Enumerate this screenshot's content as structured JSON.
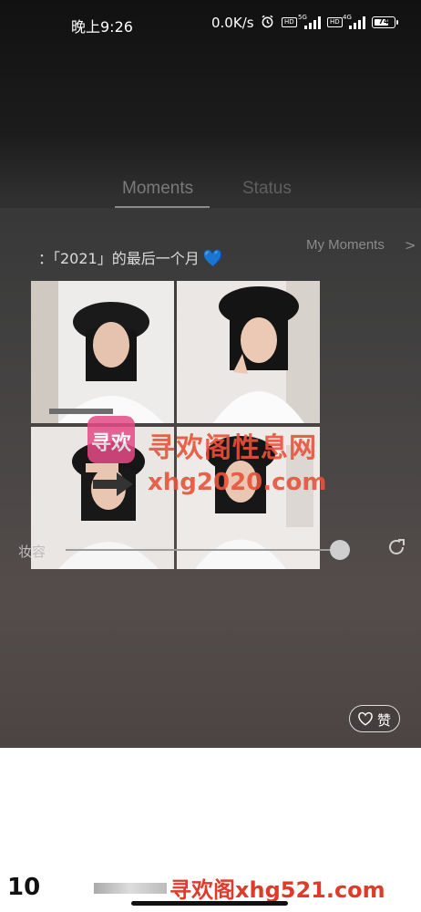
{
  "status_bar": {
    "time": "晚上9:26",
    "net_speed": "0.0K/s",
    "sim1_tag": "5G",
    "sim2_tag": "4G",
    "hd_label": "HD",
    "battery": "74",
    "battery_level": 0.74,
    "icons": [
      "alarm-icon",
      "signal-icon",
      "battery-icon"
    ]
  },
  "tabs": [
    {
      "label": "Moments",
      "active": true
    },
    {
      "label": "Status",
      "active": false
    }
  ],
  "my_moments_link": "My Moments",
  "post": {
    "text": "：「2021」的最后一个月",
    "emoji": "💙",
    "photos": [
      "photo-1",
      "photo-2",
      "photo-3",
      "photo-4"
    ]
  },
  "watermark": {
    "logo_text": "寻欢",
    "title": "寻欢阁性息网",
    "url": "xhg2020.com",
    "footer": "寻欢阁xhg521.com"
  },
  "slider": {
    "label": "妆容",
    "value": 0.97
  },
  "like_button": {
    "label": "赞",
    "icon": "heart-outline-icon"
  },
  "bottom": {
    "number": "10"
  },
  "colors": {
    "accent_blue": "#3b7fe0",
    "watermark_red": "#e8533a",
    "logo_pink": "#e64a86"
  }
}
